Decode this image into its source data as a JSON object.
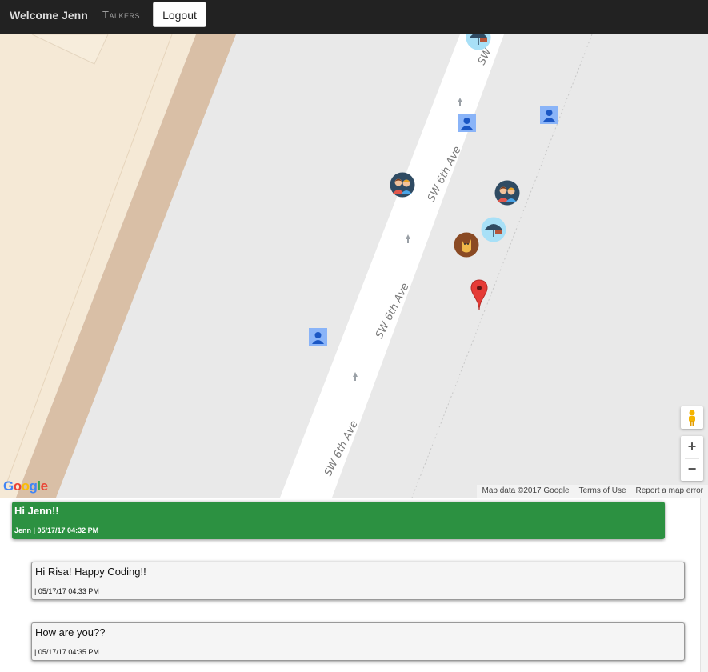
{
  "navbar": {
    "welcome": "Welcome Jenn",
    "talkers": "Talkers",
    "logout": "Logout"
  },
  "map": {
    "street_name": "SW 6th Ave",
    "street_label_partial": "SW",
    "google_logo": "Google",
    "footer": {
      "map_data": "Map data ©2017 Google",
      "terms": "Terms of Use",
      "report": "Report a map error"
    },
    "zoom_in": "+",
    "zoom_out": "−",
    "colors": {
      "land": "#e9e9e9",
      "building": "#f5e9d6",
      "sidewalk": "#d9bfa6",
      "road": "#ffffff",
      "pin": "#e53b36"
    },
    "markers": [
      {
        "icon": "person-icon"
      },
      {
        "icon": "person-icon"
      },
      {
        "icon": "person-icon"
      },
      {
        "icon": "couple-avatar-icon"
      },
      {
        "icon": "couple-avatar-icon"
      },
      {
        "icon": "umbrella-avatar-icon"
      },
      {
        "icon": "umbrella-avatar-icon"
      },
      {
        "icon": "dog-avatar-icon"
      },
      {
        "icon": "map-pin-icon"
      }
    ]
  },
  "messages": [
    {
      "text": "Hi Jenn!!",
      "meta": "Jenn | 05/17/17 04:32 PM",
      "mine": true
    },
    {
      "text": "Hi Risa! Happy Coding!!",
      "meta": "| 05/17/17 04:33 PM",
      "mine": false
    },
    {
      "text": "How are you??",
      "meta": "| 05/17/17 04:35 PM",
      "mine": false
    }
  ],
  "colors": {
    "navbar": "#222222",
    "my_message": "#2c9141",
    "other_message": "#f5f5f5"
  }
}
